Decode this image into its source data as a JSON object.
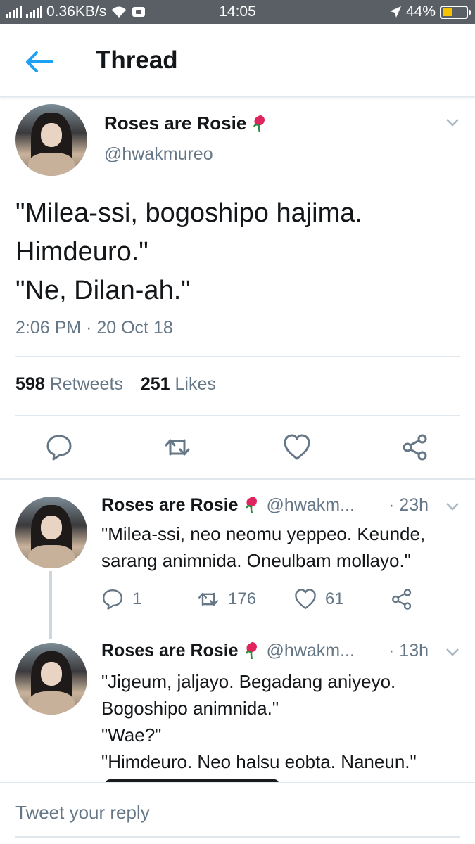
{
  "status_bar": {
    "speed": "0.36KB/s",
    "time": "14:05",
    "battery": "44%",
    "battery_level": 0.44,
    "icons": [
      "signal-icon",
      "signal-icon",
      "wifi-icon",
      "message-icon",
      "location-icon",
      "battery-icon"
    ]
  },
  "header": {
    "title": "Thread",
    "back_icon": "back-arrow-icon"
  },
  "tweet": {
    "name": "Roses are Rosie",
    "emoji": "rose-icon",
    "handle": "@hwakmureo",
    "text": "\"Milea-ssi, bogoshipo hajima.\nHimdeuro.\"\n\"Ne, Dilan-ah.\"",
    "timestamp": "2:06 PM · 20 Oct 18",
    "retweets_count": "598",
    "retweets_label": "Retweets",
    "likes_count": "251",
    "likes_label": "Likes",
    "actions": [
      "reply-icon",
      "retweet-icon",
      "like-icon",
      "share-icon"
    ]
  },
  "replies": [
    {
      "name": "Roses are Rosie",
      "handle": "@hwakm...",
      "time": "· 23h",
      "text": "\"Milea-ssi, neo neomu yeppeo. Keunde,\nsarang animnida. Oneulbam mollayo.\"",
      "reply_count": "1",
      "retweet_count": "176",
      "like_count": "61"
    },
    {
      "name": "Roses are Rosie",
      "handle": "@hwakm...",
      "time": "· 13h",
      "text": "\"Jigeum, jaljayo. Begadang aniyeyo.\nBogoshipo animnida.\"\n\"Wae?\"\n\"Himdeuro. Neo halsu eobta. Naneun.\""
    }
  ],
  "composer": {
    "placeholder": "Tweet your reply"
  },
  "colors": {
    "accent": "#1da1f2",
    "status_bar": "#5a5f66",
    "secondary_text": "#657786",
    "divider": "#e1e8ed",
    "battery": "#f5c400"
  }
}
